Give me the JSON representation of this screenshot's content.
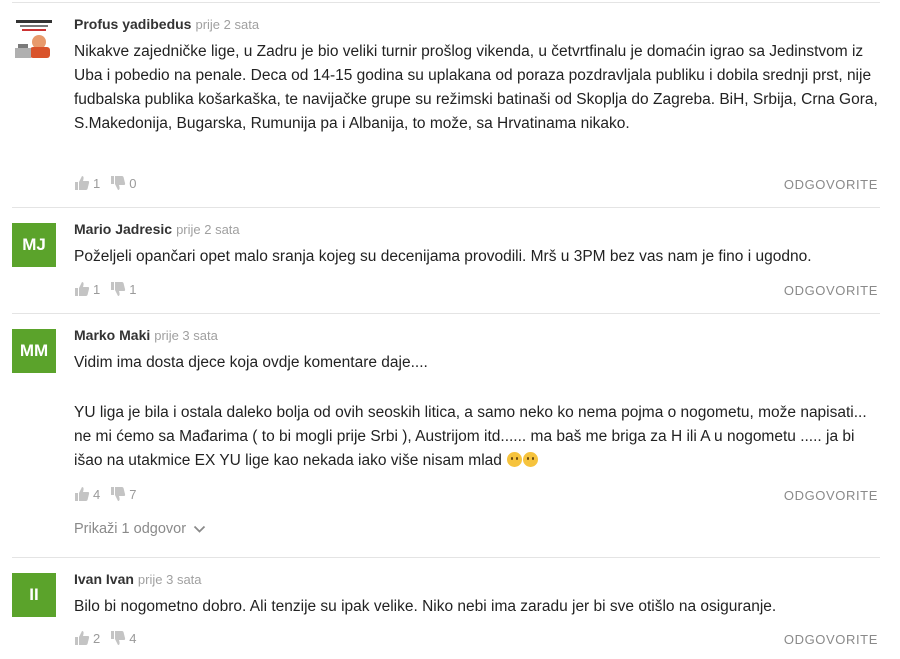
{
  "reply_label": "ODGOVORITE",
  "comments": [
    {
      "author": "Profus yadibedus",
      "time": "prije 2 sata",
      "avatar_initials": "",
      "paragraphs": [
        "Nikakve zajedničke lige, u Zadru je bio veliki turnir prošlog vikenda, u četvrtfinalu je domaćin igrao sa Jedinstvom iz Uba i pobedio na penale. Deca od 14-15 godina su uplakana od poraza pozdravljala publiku i dobila srednji prst, nije fudbalska publika košarkaška, te navijačke grupe su režimski batinaši od Skoplja do Zagreba. BiH, Srbija, Crna Gora, S.Makedonija, Bugarska, Rumunija pa i Albanija, to može, sa Hrvatinama nikako."
      ],
      "likes": "1",
      "dislikes": "0"
    },
    {
      "author": "Mario Jadresic",
      "time": "prije 2 sata",
      "avatar_initials": "MJ",
      "paragraphs": [
        "Poželjeli opančari opet malo sranja kojeg su decenijama provodili. Mrš u 3PM bez vas nam je fino i ugodno."
      ],
      "likes": "1",
      "dislikes": "1"
    },
    {
      "author": "Marko Maki",
      "time": "prije 3 sata",
      "avatar_initials": "MM",
      "paragraphs": [
        "Vidim ima dosta djece koja ovdje komentare daje....",
        "YU liga je bila i ostala daleko bolja od ovih seoskih litica, a samo neko ko nema pojma o nogometu, može napisati... ne mi ćemo sa Mađarima ( to bi mogli prije Srbi ), Austrijom itd...... ma baš me briga za H ili A u nogometu ..... ja bi išao na utakmice EX YU lige kao nekada iako više nisam mlad"
      ],
      "likes": "4",
      "dislikes": "7",
      "show_replies": "Prikaži 1 odgovor"
    },
    {
      "author": "Ivan Ivan",
      "time": "prije 3 sata",
      "avatar_initials": "II",
      "paragraphs": [
        "Bilo bi nogometno dobro. Ali tenzije su ipak velike. Niko nebi ima zaradu jer bi sve otišlo na osiguranje."
      ],
      "likes": "2",
      "dislikes": "4"
    }
  ],
  "colors": {
    "avatar_bg": "#5ba32b",
    "divider": "#e4e4e4",
    "muted": "#9a9a9a"
  }
}
